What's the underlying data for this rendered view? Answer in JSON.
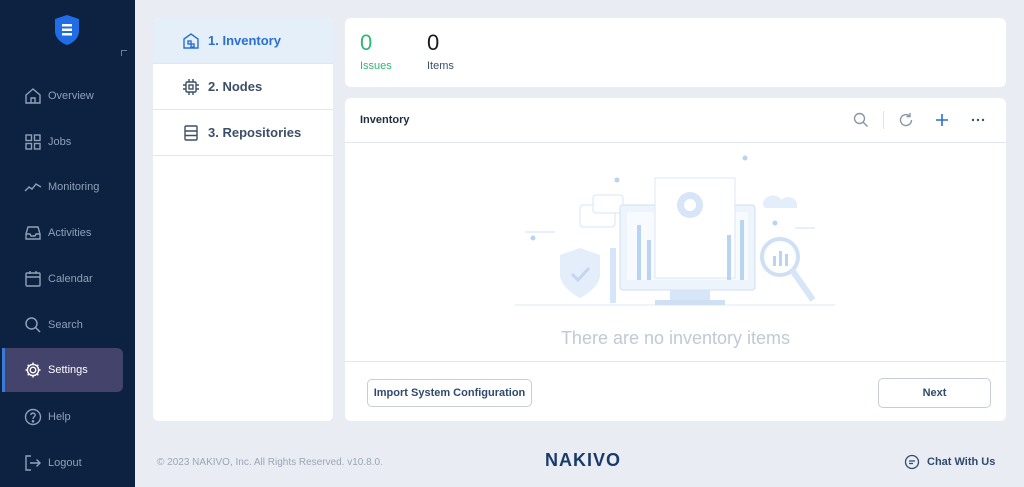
{
  "sidebar": {
    "items": [
      {
        "label": "Overview",
        "icon": "home-icon"
      },
      {
        "label": "Jobs",
        "icon": "grid-icon"
      },
      {
        "label": "Monitoring",
        "icon": "chart-line-icon"
      },
      {
        "label": "Activities",
        "icon": "inbox-icon"
      },
      {
        "label": "Calendar",
        "icon": "calendar-icon"
      },
      {
        "label": "Search",
        "icon": "search-icon"
      },
      {
        "label": "Settings",
        "icon": "gear-icon",
        "active": true
      },
      {
        "label": "Help",
        "icon": "question-icon"
      },
      {
        "label": "Logout",
        "icon": "logout-icon"
      }
    ]
  },
  "steps": [
    {
      "label": "1. Inventory",
      "icon": "inventory-icon",
      "active": true
    },
    {
      "label": "2. Nodes",
      "icon": "chip-icon"
    },
    {
      "label": "3. Repositories",
      "icon": "repository-icon"
    }
  ],
  "stats": {
    "issues": {
      "value": "0",
      "label": "Issues"
    },
    "items": {
      "value": "0",
      "label": "Items"
    }
  },
  "inventory": {
    "title": "Inventory",
    "empty_text": "There are no inventory items",
    "import_label": "Import System Configuration",
    "next_label": "Next"
  },
  "footer": {
    "copyright": "© 2023 NAKIVO, Inc. All Rights Reserved. v10.8.0.",
    "brand": "NAKIVO",
    "chat_label": "Chat With Us"
  },
  "colors": {
    "sidebar_bg": "#0d2240",
    "active_nav": "#43436b",
    "accent": "#2a6fd1",
    "issues_green": "#2eb872"
  }
}
